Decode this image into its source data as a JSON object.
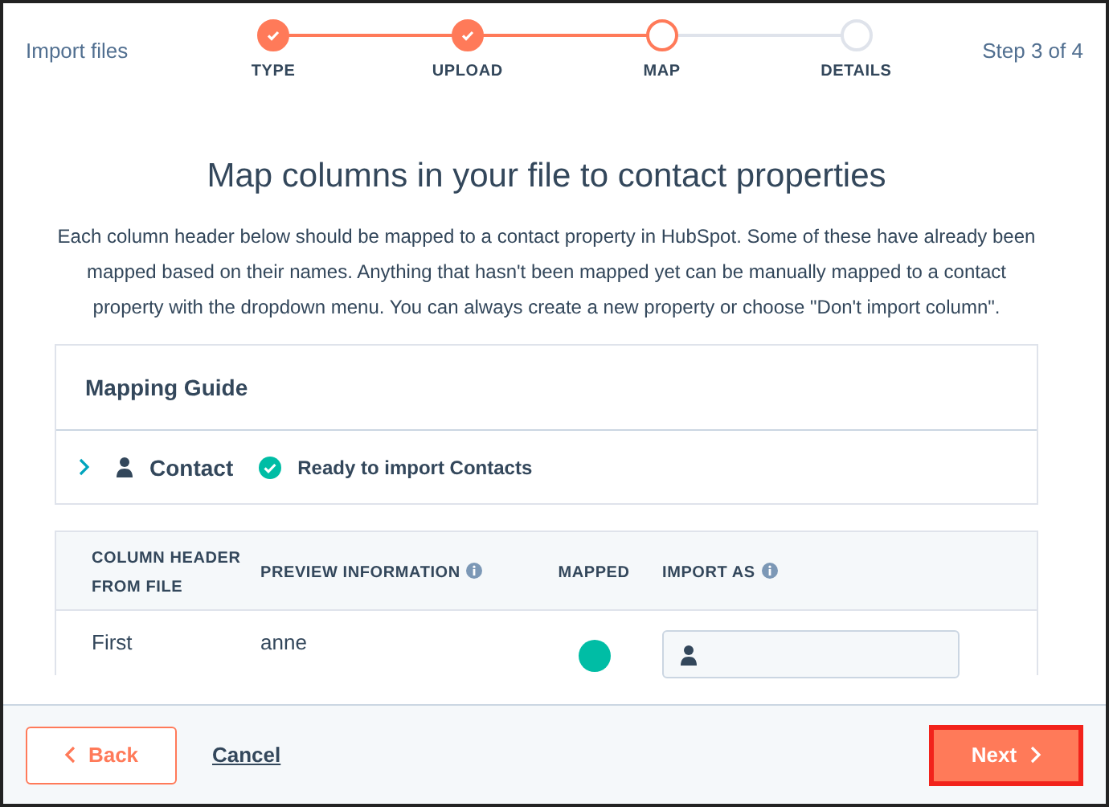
{
  "header": {
    "title": "Import files",
    "step_label": "Step 3 of 4"
  },
  "steps": [
    {
      "label": "TYPE",
      "done": true,
      "current": false
    },
    {
      "label": "UPLOAD",
      "done": true,
      "current": false
    },
    {
      "label": "MAP",
      "done": false,
      "current": true
    },
    {
      "label": "DETAILS",
      "done": false,
      "current": false
    }
  ],
  "heading": "Map columns in your file to contact properties",
  "description": "Each column header below should be mapped to a contact property in HubSpot. Some of these have already been mapped based on their names. Anything that hasn't been mapped yet can be manually mapped to a contact property with the dropdown menu. You can always create a new property or choose \"Don't import column\".",
  "mapping_guide": {
    "title": "Mapping Guide",
    "object": "Contact",
    "expanded": false,
    "status": "Ready to import Contacts"
  },
  "table": {
    "columns": [
      {
        "label": "COLUMN HEADER FROM FILE",
        "info": false
      },
      {
        "label": "PREVIEW INFORMATION",
        "info": true
      },
      {
        "label": "MAPPED",
        "info": false
      },
      {
        "label": "IMPORT AS",
        "info": true
      }
    ],
    "rows": [
      {
        "column_header": "First",
        "preview": "anne",
        "mapped": true
      }
    ]
  },
  "footer": {
    "back": "Back",
    "cancel": "Cancel",
    "next": "Next"
  }
}
